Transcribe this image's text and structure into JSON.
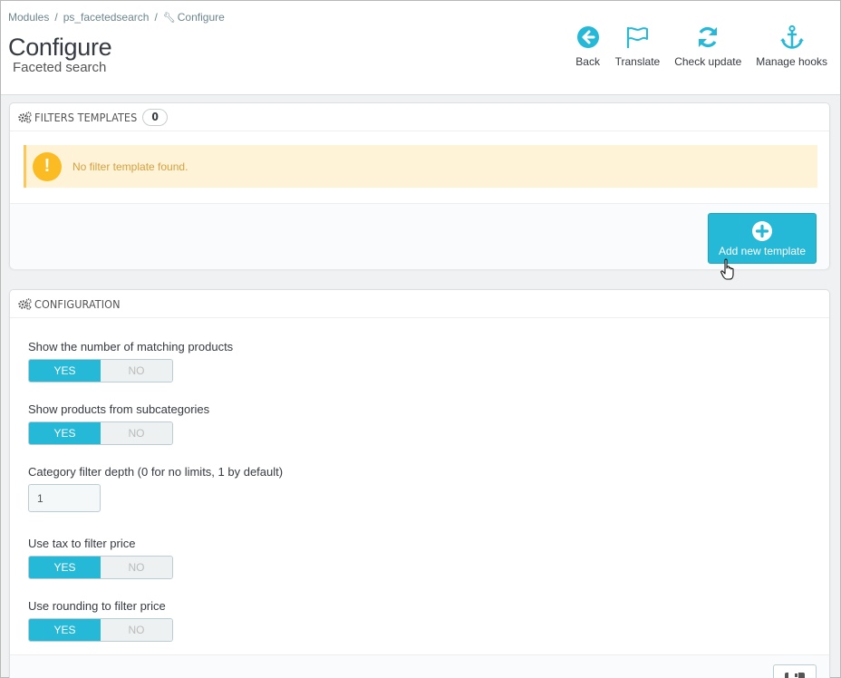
{
  "breadcrumb": {
    "items": [
      "Modules",
      "ps_facetedsearch",
      "Configure"
    ]
  },
  "header": {
    "title": "Configure",
    "subtitle": "Faceted search"
  },
  "toolbar": {
    "back": "Back",
    "translate": "Translate",
    "check_update": "Check update",
    "manage_hooks": "Manage hooks"
  },
  "filters_panel": {
    "heading": "FILTERS TEMPLATES",
    "count": "0",
    "alert": "No filter template found.",
    "add_button": "Add new template"
  },
  "config_panel": {
    "heading": "CONFIGURATION",
    "fields": [
      {
        "label": "Show the number of matching products",
        "yes": "YES",
        "no": "NO"
      },
      {
        "label": "Show products from subcategories",
        "yes": "YES",
        "no": "NO"
      },
      {
        "label": "Category filter depth (0 for no limits, 1 by default)",
        "value": "1"
      },
      {
        "label": "Use tax to filter price",
        "yes": "YES",
        "no": "NO"
      },
      {
        "label": "Use rounding to filter price",
        "yes": "YES",
        "no": "NO"
      }
    ]
  },
  "colors": {
    "accent": "#25b9d7",
    "warning_bg": "#fff3d7",
    "warning_icon": "#fbbb22"
  }
}
